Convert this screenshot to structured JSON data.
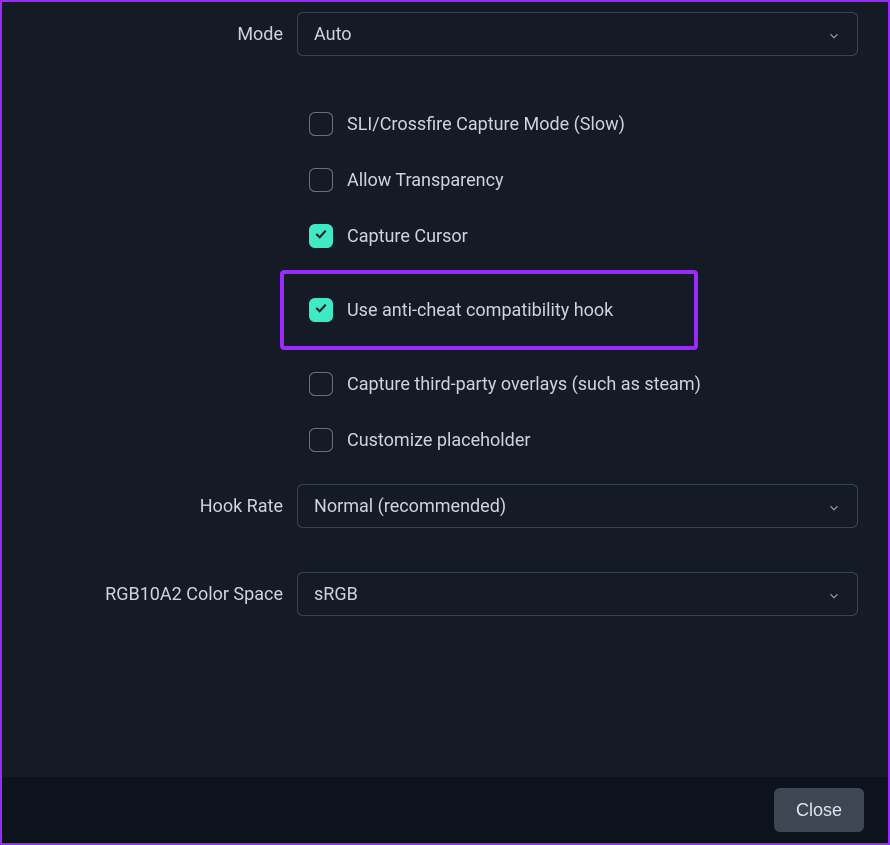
{
  "mode": {
    "label": "Mode",
    "value": "Auto"
  },
  "checkboxes": {
    "sli": {
      "label": "SLI/Crossfire Capture Mode (Slow)",
      "checked": false
    },
    "allow_transparency": {
      "label": "Allow Transparency",
      "checked": false
    },
    "capture_cursor": {
      "label": "Capture Cursor",
      "checked": true
    },
    "anticheat": {
      "label": "Use anti-cheat compatibility hook",
      "checked": true
    },
    "third_party": {
      "label": "Capture third-party overlays (such as steam)",
      "checked": false
    },
    "customize_placeholder": {
      "label": "Customize placeholder",
      "checked": false
    }
  },
  "hook_rate": {
    "label": "Hook Rate",
    "value": "Normal (recommended)"
  },
  "color_space": {
    "label": "RGB10A2 Color Space",
    "value": "sRGB"
  },
  "footer": {
    "close": "Close"
  },
  "colors": {
    "accent": "#3fe9c3",
    "highlight": "#9b2aff",
    "bg": "#151b26",
    "footer_bg": "#0d131c",
    "border": "#3a4250"
  }
}
